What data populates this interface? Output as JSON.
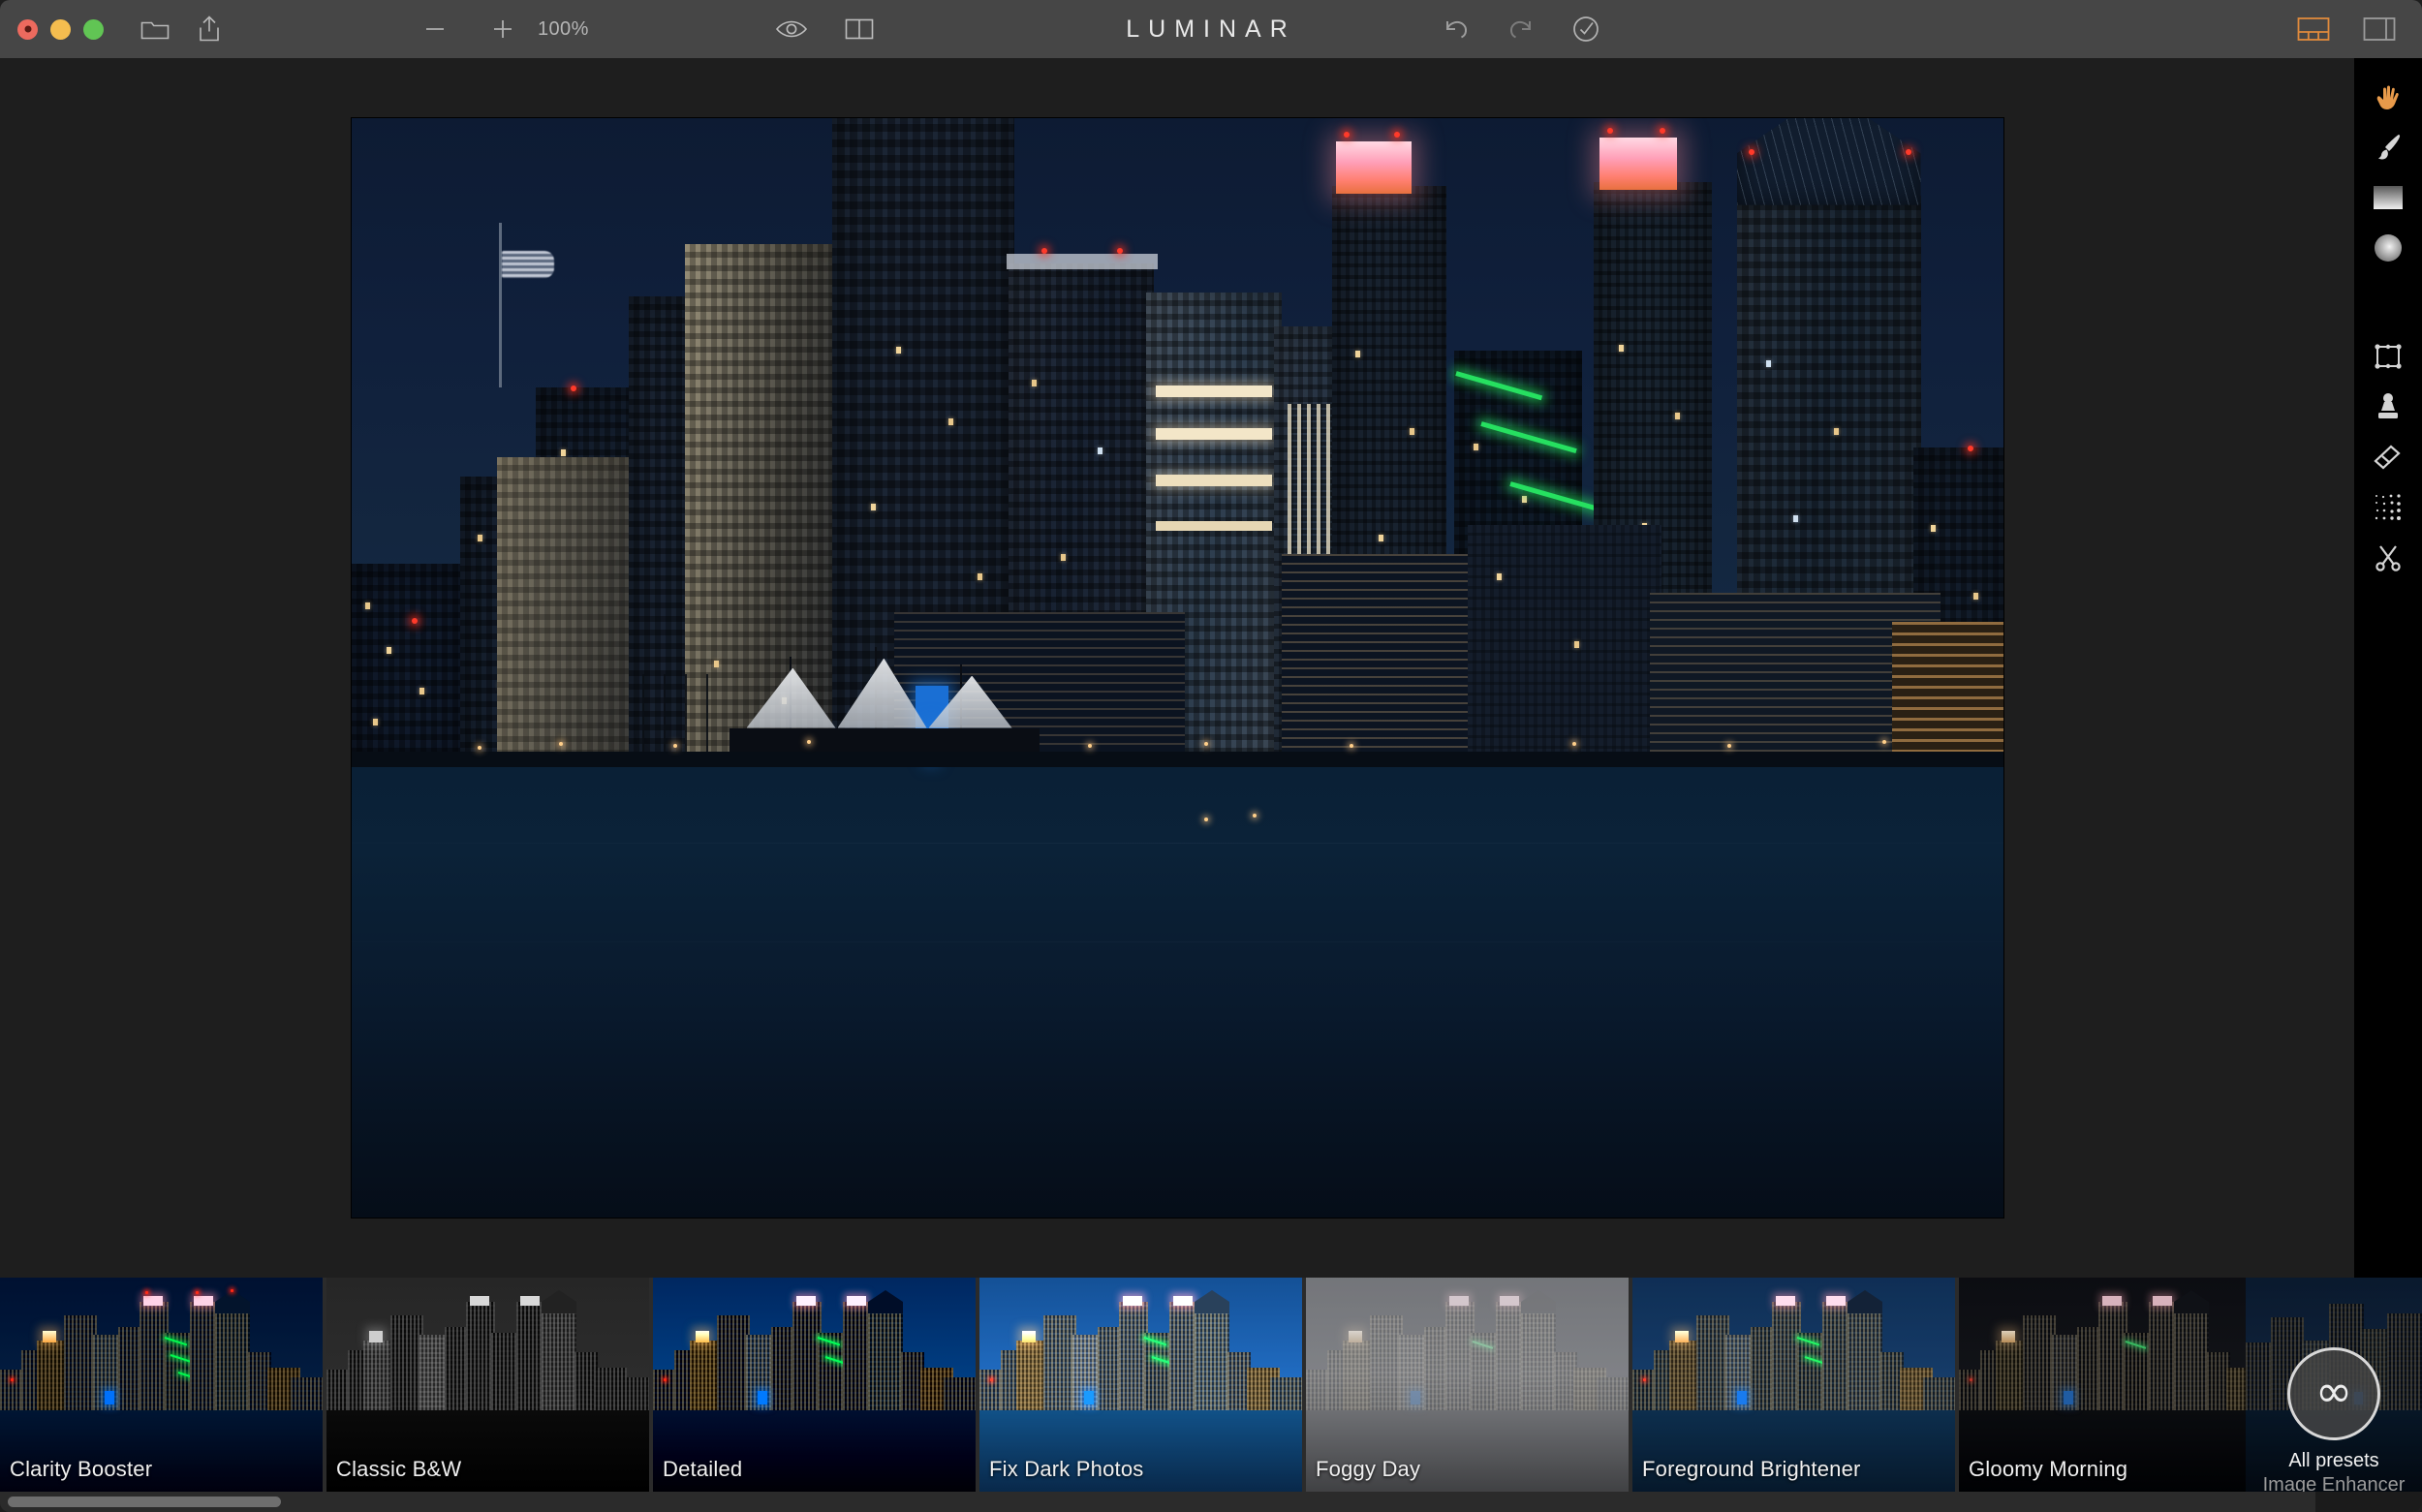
{
  "app": {
    "title": "LUMINAR",
    "accent": "#e08a3c",
    "titlebar_bg": "#464646",
    "workspace_bg": "#1e1e1e",
    "rail_bg": "#000000",
    "filmstrip_bg": "#2b2b2b"
  },
  "window_controls": {
    "close_label": "Close",
    "minimize_label": "Minimize",
    "maximize_label": "Maximize"
  },
  "toolbar": {
    "open_label": "Open Image",
    "open_icon": "folder-icon",
    "share_label": "Share",
    "share_icon": "share-icon",
    "zoom_out_label": "Zoom Out",
    "zoom_out_icon": "minus-icon",
    "zoom_in_label": "Zoom In",
    "zoom_in_icon": "plus-icon",
    "zoom_value": "100%",
    "preview_label": "Quick Preview",
    "preview_icon": "eye-icon",
    "compare_label": "Compare Before/After",
    "compare_icon": "split-view-icon",
    "undo_label": "Undo",
    "undo_icon": "undo-arrow-icon",
    "redo_label": "Redo",
    "redo_icon": "redo-arrow-icon",
    "history_label": "History",
    "history_icon": "clock-check-icon",
    "filmstrip_toggle_label": "Show Presets Panel",
    "filmstrip_toggle_icon": "filmstrip-panel-icon",
    "filmstrip_toggle_active": true,
    "sidepanel_toggle_label": "Show Side Panel",
    "sidepanel_toggle_icon": "side-panel-icon",
    "sidepanel_toggle_active": false
  },
  "tools": [
    {
      "name": "hand-tool",
      "label": "Pan",
      "icon": "hand-icon",
      "active": true
    },
    {
      "name": "brush-tool",
      "label": "Brush Mask",
      "icon": "brush-icon",
      "active": false
    },
    {
      "name": "gradient-tool",
      "label": "Gradient Mask",
      "icon": "gradient-icon",
      "active": false
    },
    {
      "name": "radial-tool",
      "label": "Radial Mask",
      "icon": "radial-mask-icon",
      "active": false
    },
    {
      "name": "crop-tool",
      "label": "Crop",
      "icon": "crop-icon",
      "active": false
    },
    {
      "name": "clone-tool",
      "label": "Clone & Stamp",
      "icon": "stamp-icon",
      "active": false
    },
    {
      "name": "erase-tool",
      "label": "Erase",
      "icon": "eraser-icon",
      "active": false
    },
    {
      "name": "denoise-tool",
      "label": "Denoise",
      "icon": "grain-icon",
      "active": false
    },
    {
      "name": "cut-tool",
      "label": "Cut",
      "icon": "scissors-icon",
      "active": false
    }
  ],
  "canvas": {
    "image_title": "San Diego skyline at night",
    "zoom": "100%"
  },
  "filmstrip": {
    "presets": [
      {
        "label": "Clarity Booster",
        "fx": "fx-clarity",
        "selected": true
      },
      {
        "label": "Classic B&W",
        "fx": "fx-bw",
        "selected": false
      },
      {
        "label": "Detailed",
        "fx": "fx-detailed",
        "selected": false
      },
      {
        "label": "Fix Dark Photos",
        "fx": "fx-fixdark",
        "selected": false
      },
      {
        "label": "Foggy Day",
        "fx": "fx-foggy",
        "selected": false
      },
      {
        "label": "Foreground Brightener",
        "fx": "fx-fg",
        "selected": false
      },
      {
        "label": "Gloomy Morning",
        "fx": "fx-gloomy",
        "selected": false
      }
    ],
    "all_presets": {
      "icon": "infinity-icon",
      "line1": "All presets",
      "line2": "Image Enhancer"
    },
    "scrollbar_label": "Presets horizontal scrollbar"
  }
}
